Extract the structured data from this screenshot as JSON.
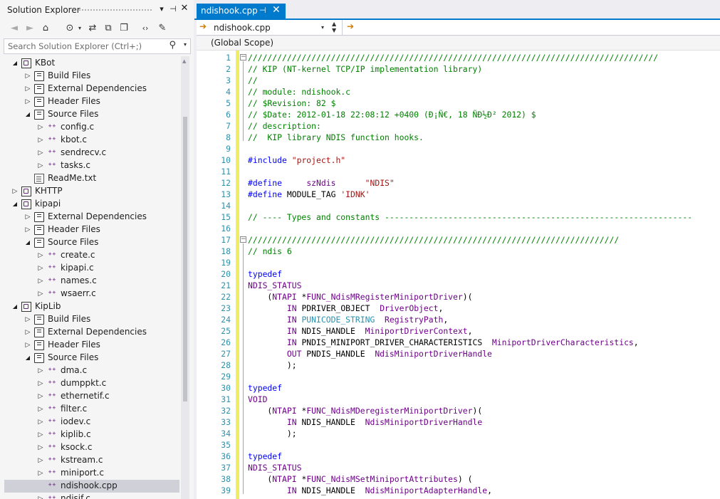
{
  "solution_explorer": {
    "title": "Solution Explorer",
    "search_placeholder": "Search Solution Explorer (Ctrl+;)",
    "tree": [
      {
        "label": "KBot",
        "kind": "project",
        "level": 0,
        "state": "open"
      },
      {
        "label": "Build Files",
        "kind": "folder",
        "level": 1,
        "state": "closed"
      },
      {
        "label": "External Dependencies",
        "kind": "folder",
        "level": 1,
        "state": "closed"
      },
      {
        "label": "Header Files",
        "kind": "folder",
        "level": 1,
        "state": "closed"
      },
      {
        "label": "Source Files",
        "kind": "folder",
        "level": 1,
        "state": "open"
      },
      {
        "label": "config.c",
        "kind": "cfile",
        "level": 2,
        "state": "closed"
      },
      {
        "label": "kbot.c",
        "kind": "cfile",
        "level": 2,
        "state": "closed"
      },
      {
        "label": "sendrecv.c",
        "kind": "cfile",
        "level": 2,
        "state": "closed"
      },
      {
        "label": "tasks.c",
        "kind": "cfile",
        "level": 2,
        "state": "closed"
      },
      {
        "label": "ReadMe.txt",
        "kind": "txt",
        "level": 1,
        "state": "none"
      },
      {
        "label": "KHTTP",
        "kind": "project",
        "level": 0,
        "state": "closed"
      },
      {
        "label": "kipapi",
        "kind": "project",
        "level": 0,
        "state": "open"
      },
      {
        "label": "External Dependencies",
        "kind": "folder",
        "level": 1,
        "state": "closed"
      },
      {
        "label": "Header Files",
        "kind": "folder",
        "level": 1,
        "state": "closed"
      },
      {
        "label": "Source Files",
        "kind": "folder",
        "level": 1,
        "state": "open"
      },
      {
        "label": "create.c",
        "kind": "cfile",
        "level": 2,
        "state": "closed"
      },
      {
        "label": "kipapi.c",
        "kind": "cfile",
        "level": 2,
        "state": "closed"
      },
      {
        "label": "names.c",
        "kind": "cfile",
        "level": 2,
        "state": "closed"
      },
      {
        "label": "wsaerr.c",
        "kind": "cfile",
        "level": 2,
        "state": "closed"
      },
      {
        "label": "KipLib",
        "kind": "project",
        "level": 0,
        "state": "open"
      },
      {
        "label": "Build Files",
        "kind": "folder",
        "level": 1,
        "state": "closed"
      },
      {
        "label": "External Dependencies",
        "kind": "folder",
        "level": 1,
        "state": "closed"
      },
      {
        "label": "Header Files",
        "kind": "folder",
        "level": 1,
        "state": "closed"
      },
      {
        "label": "Source Files",
        "kind": "folder",
        "level": 1,
        "state": "open"
      },
      {
        "label": "dma.c",
        "kind": "cfile",
        "level": 2,
        "state": "closed"
      },
      {
        "label": "dumppkt.c",
        "kind": "cfile",
        "level": 2,
        "state": "closed"
      },
      {
        "label": "ethernetif.c",
        "kind": "cfile",
        "level": 2,
        "state": "closed"
      },
      {
        "label": "filter.c",
        "kind": "cfile",
        "level": 2,
        "state": "closed"
      },
      {
        "label": "iodev.c",
        "kind": "cfile",
        "level": 2,
        "state": "closed"
      },
      {
        "label": "kiplib.c",
        "kind": "cfile",
        "level": 2,
        "state": "closed"
      },
      {
        "label": "ksock.c",
        "kind": "cfile",
        "level": 2,
        "state": "closed"
      },
      {
        "label": "kstream.c",
        "kind": "cfile",
        "level": 2,
        "state": "closed"
      },
      {
        "label": "miniport.c",
        "kind": "cfile",
        "level": 2,
        "state": "closed"
      },
      {
        "label": "ndishook.cpp",
        "kind": "cfile",
        "level": 2,
        "state": "none",
        "selected": true
      },
      {
        "label": "ndisif.c",
        "kind": "cfile",
        "level": 2,
        "state": "closed"
      }
    ]
  },
  "editor": {
    "tab_label": "ndishook.cpp",
    "nav_file": "ndishook.cpp",
    "scope": "(Global Scope)",
    "lines": [
      {
        "n": 1,
        "fold": "open",
        "t": [
          [
            "c",
            "////////////////////////////////////////////////////////////////////////////////////"
          ]
        ]
      },
      {
        "n": 2,
        "t": [
          [
            "c",
            "// KIP (NT-kernel TCP/IP implementation library)"
          ]
        ]
      },
      {
        "n": 3,
        "t": [
          [
            "c",
            "//"
          ]
        ]
      },
      {
        "n": 4,
        "t": [
          [
            "c",
            "// module: ndishook.c"
          ]
        ]
      },
      {
        "n": 5,
        "t": [
          [
            "c",
            "// $Revision: 82 $"
          ]
        ]
      },
      {
        "n": 6,
        "t": [
          [
            "c",
            "// $Date: 2012-01-18 22:08:12 +0400 (Đ¡Ñ€, 18 ÑĐ½Đ² 2012) $"
          ]
        ]
      },
      {
        "n": 7,
        "t": [
          [
            "c",
            "// description:"
          ]
        ]
      },
      {
        "n": 8,
        "t": [
          [
            "c",
            "//  KIP library NDIS function hooks."
          ]
        ]
      },
      {
        "n": 9,
        "t": []
      },
      {
        "n": 10,
        "t": [
          [
            "k",
            "#include "
          ],
          [
            "s",
            "\"project.h\""
          ]
        ]
      },
      {
        "n": 11,
        "t": []
      },
      {
        "n": 12,
        "t": [
          [
            "k",
            "#define"
          ],
          [
            "tx",
            "     "
          ],
          [
            "m",
            "szNdis"
          ],
          [
            "tx",
            "      "
          ],
          [
            "s",
            "\"NDIS\""
          ]
        ]
      },
      {
        "n": 13,
        "t": [
          [
            "k",
            "#define"
          ],
          [
            "tx",
            " MODULE_TAG "
          ],
          [
            "s",
            "'IDNK'"
          ]
        ]
      },
      {
        "n": 14,
        "t": []
      },
      {
        "n": 15,
        "t": [
          [
            "c",
            "// ---- Types and constants ---------------------------------------------------------------"
          ]
        ]
      },
      {
        "n": 16,
        "t": []
      },
      {
        "n": 17,
        "fold": "open",
        "t": [
          [
            "c",
            "////////////////////////////////////////////////////////////////////////////"
          ]
        ]
      },
      {
        "n": 18,
        "t": [
          [
            "c",
            "// ndis 6"
          ]
        ]
      },
      {
        "n": 19,
        "t": []
      },
      {
        "n": 20,
        "t": [
          [
            "k",
            "typedef"
          ]
        ]
      },
      {
        "n": 21,
        "t": [
          [
            "m",
            "NDIS_STATUS"
          ]
        ]
      },
      {
        "n": 22,
        "t": [
          [
            "tx",
            "    ("
          ],
          [
            "m",
            "NTAPI"
          ],
          [
            "tx",
            " *"
          ],
          [
            "m",
            "FUNC_NdisMRegisterMiniportDriver"
          ],
          [
            "tx",
            ")("
          ]
        ]
      },
      {
        "n": 23,
        "t": [
          [
            "tx",
            "        "
          ],
          [
            "m",
            "IN"
          ],
          [
            "tx",
            " PDRIVER_OBJECT  "
          ],
          [
            "m",
            "DriverObject"
          ],
          [
            "tx",
            ","
          ]
        ]
      },
      {
        "n": 24,
        "t": [
          [
            "tx",
            "        "
          ],
          [
            "m",
            "IN"
          ],
          [
            "tx",
            " "
          ],
          [
            "ty",
            "PUNICODE_STRING"
          ],
          [
            "tx",
            "  "
          ],
          [
            "m",
            "RegistryPath"
          ],
          [
            "tx",
            ","
          ]
        ]
      },
      {
        "n": 25,
        "t": [
          [
            "tx",
            "        "
          ],
          [
            "m",
            "IN"
          ],
          [
            "tx",
            " NDIS_HANDLE  "
          ],
          [
            "m",
            "MiniportDriverContext"
          ],
          [
            "tx",
            ","
          ]
        ]
      },
      {
        "n": 26,
        "t": [
          [
            "tx",
            "        "
          ],
          [
            "m",
            "IN"
          ],
          [
            "tx",
            " PNDIS_MINIPORT_DRIVER_CHARACTERISTICS  "
          ],
          [
            "m",
            "MiniportDriverCharacteristics"
          ],
          [
            "tx",
            ","
          ]
        ]
      },
      {
        "n": 27,
        "t": [
          [
            "tx",
            "        "
          ],
          [
            "m",
            "OUT"
          ],
          [
            "tx",
            " PNDIS_HANDLE  "
          ],
          [
            "m",
            "NdisMiniportDriverHandle"
          ]
        ]
      },
      {
        "n": 28,
        "t": [
          [
            "tx",
            "        );"
          ]
        ]
      },
      {
        "n": 29,
        "t": []
      },
      {
        "n": 30,
        "t": [
          [
            "k",
            "typedef"
          ]
        ]
      },
      {
        "n": 31,
        "t": [
          [
            "m",
            "VOID"
          ]
        ]
      },
      {
        "n": 32,
        "t": [
          [
            "tx",
            "    ("
          ],
          [
            "m",
            "NTAPI"
          ],
          [
            "tx",
            " *"
          ],
          [
            "m",
            "FUNC_NdisMDeregisterMiniportDriver"
          ],
          [
            "tx",
            ")("
          ]
        ]
      },
      {
        "n": 33,
        "t": [
          [
            "tx",
            "        "
          ],
          [
            "m",
            "IN"
          ],
          [
            "tx",
            " NDIS_HANDLE  "
          ],
          [
            "m",
            "NdisMiniportDriverHandle"
          ]
        ]
      },
      {
        "n": 34,
        "t": [
          [
            "tx",
            "        );"
          ]
        ]
      },
      {
        "n": 35,
        "t": []
      },
      {
        "n": 36,
        "t": [
          [
            "k",
            "typedef"
          ]
        ]
      },
      {
        "n": 37,
        "t": [
          [
            "m",
            "NDIS_STATUS"
          ]
        ]
      },
      {
        "n": 38,
        "t": [
          [
            "tx",
            "    ("
          ],
          [
            "m",
            "NTAPI"
          ],
          [
            "tx",
            " *"
          ],
          [
            "m",
            "FUNC_NdisMSetMiniportAttributes"
          ],
          [
            "tx",
            ") ("
          ]
        ]
      },
      {
        "n": 39,
        "t": [
          [
            "tx",
            "        "
          ],
          [
            "m",
            "IN"
          ],
          [
            "tx",
            " NDIS_HANDLE  "
          ],
          [
            "m",
            "NdisMiniportAdapterHandle"
          ],
          [
            "tx",
            ","
          ]
        ]
      }
    ]
  }
}
